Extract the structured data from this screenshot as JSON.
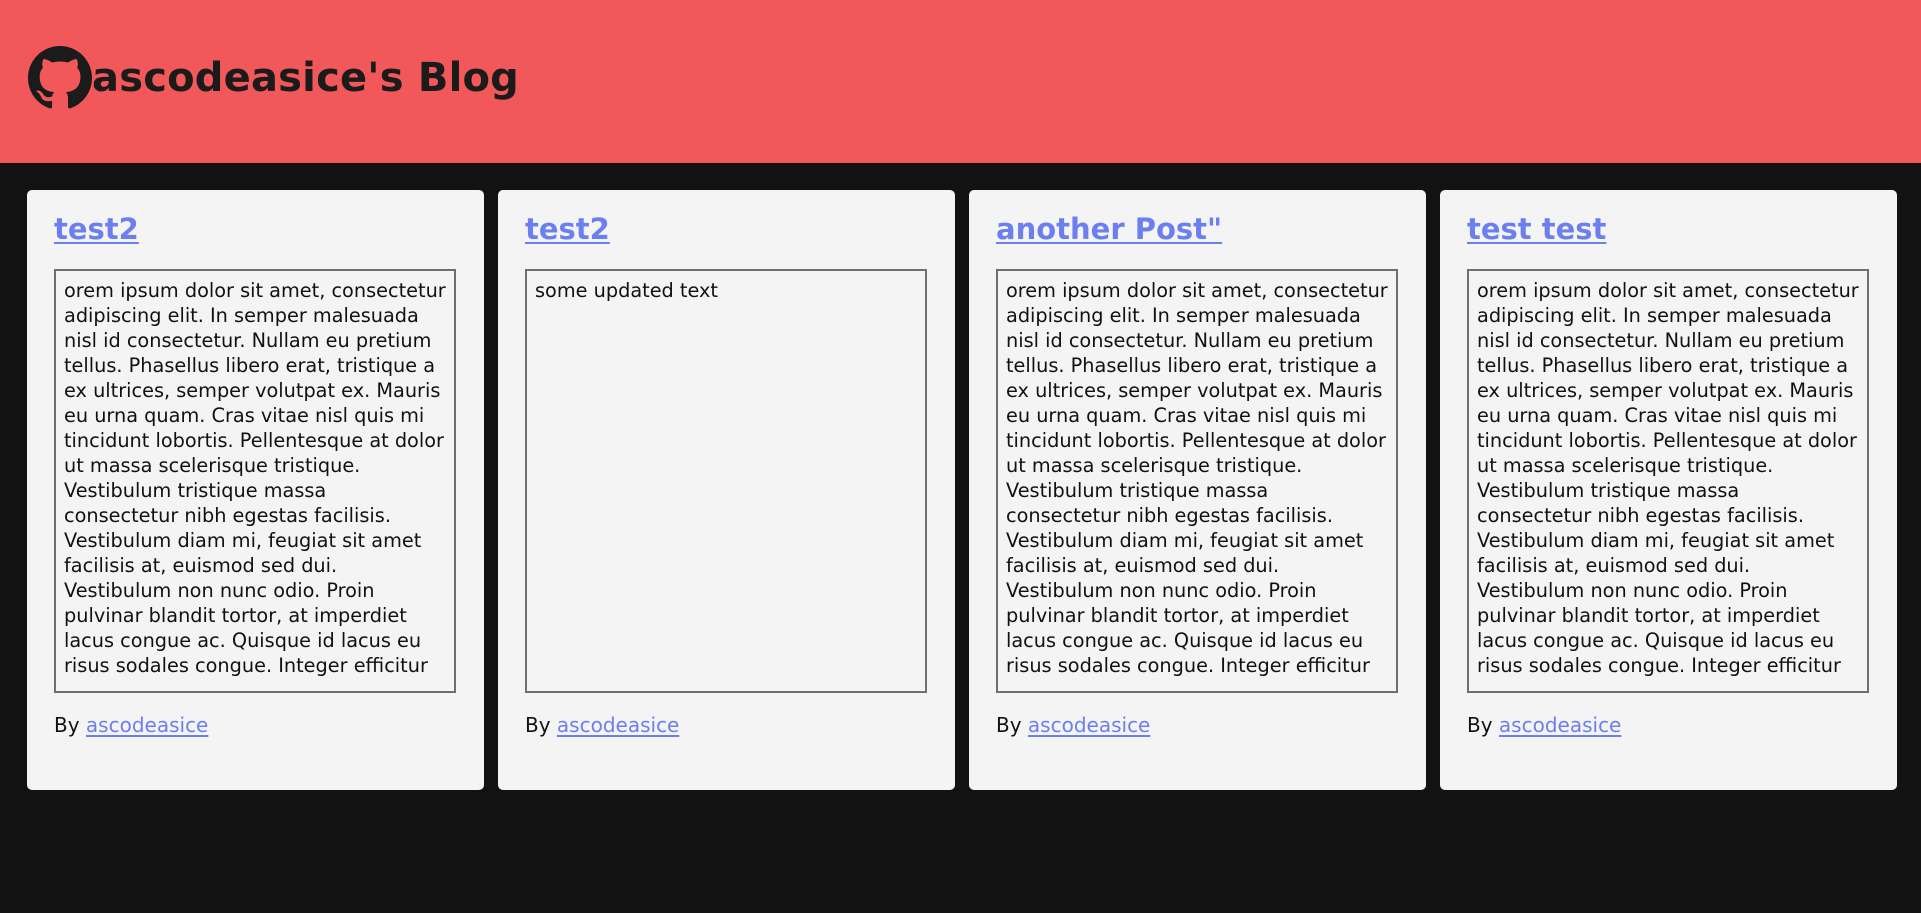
{
  "header": {
    "title": "ascodeasice's Blog",
    "logo_icon": "github-icon",
    "background_color": "#f2575a"
  },
  "colors": {
    "page_background": "#121212",
    "card_background": "#f4f4f4",
    "link": "#6c7ff0"
  },
  "posts": [
    {
      "title": "test2",
      "body": "orem ipsum dolor sit amet, consectetur adipiscing elit. In semper malesuada nisl id consectetur. Nullam eu pretium tellus. Phasellus libero erat, tristique a ex ultrices, semper volutpat ex. Mauris eu urna quam. Cras vitae nisl quis mi tincidunt lobortis. Pellentesque at dolor ut massa scelerisque tristique. Vestibulum tristique massa consectetur nibh egestas facilisis. Vestibulum diam mi, feugiat sit amet facilisis at, euismod sed dui. Vestibulum non nunc odio. Proin pulvinar blandit tortor, at imperdiet lacus congue ac. Quisque id lacus eu risus sodales congue. Integer efficitur",
      "by_label": "By",
      "author": "ascodeasice"
    },
    {
      "title": "test2",
      "body": "some updated text",
      "by_label": "By",
      "author": "ascodeasice"
    },
    {
      "title": "another Post\"",
      "body": "orem ipsum dolor sit amet, consectetur adipiscing elit. In semper malesuada nisl id consectetur. Nullam eu pretium tellus. Phasellus libero erat, tristique a ex ultrices, semper volutpat ex. Mauris eu urna quam. Cras vitae nisl quis mi tincidunt lobortis. Pellentesque at dolor ut massa scelerisque tristique. Vestibulum tristique massa consectetur nibh egestas facilisis. Vestibulum diam mi, feugiat sit amet facilisis at, euismod sed dui. Vestibulum non nunc odio. Proin pulvinar blandit tortor, at imperdiet lacus congue ac. Quisque id lacus eu risus sodales congue. Integer efficitur",
      "by_label": "By",
      "author": "ascodeasice"
    },
    {
      "title": "test test",
      "body": "orem ipsum dolor sit amet, consectetur adipiscing elit. In semper malesuada nisl id consectetur. Nullam eu pretium tellus. Phasellus libero erat, tristique a ex ultrices, semper volutpat ex. Mauris eu urna quam. Cras vitae nisl quis mi tincidunt lobortis. Pellentesque at dolor ut massa scelerisque tristique. Vestibulum tristique massa consectetur nibh egestas facilisis. Vestibulum diam mi, feugiat sit amet facilisis at, euismod sed dui. Vestibulum non nunc odio. Proin pulvinar blandit tortor, at imperdiet lacus congue ac. Quisque id lacus eu risus sodales congue. Integer efficitur",
      "by_label": "By",
      "author": "ascodeasice"
    }
  ]
}
